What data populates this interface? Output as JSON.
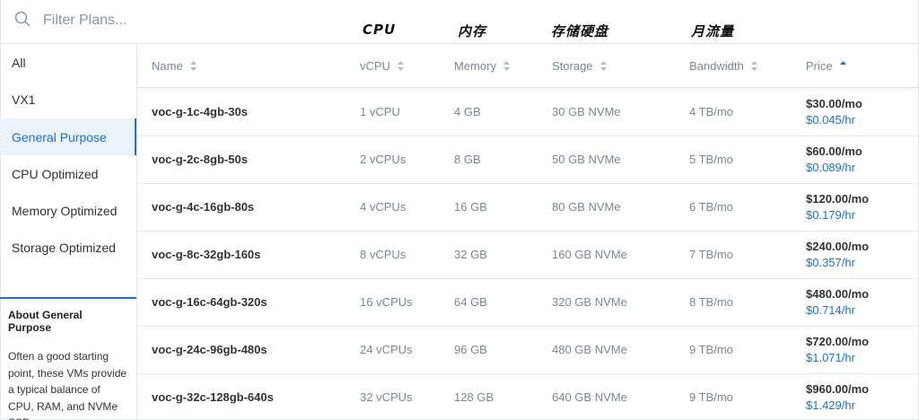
{
  "search": {
    "placeholder": "Filter Plans..."
  },
  "annotations": {
    "cpu": "CPU",
    "memory": "内存",
    "storage": "存储硬盘",
    "bandwidth": "月流量"
  },
  "sidebar": {
    "items": [
      {
        "label": "All"
      },
      {
        "label": "VX1"
      },
      {
        "label": "General Purpose"
      },
      {
        "label": "CPU Optimized"
      },
      {
        "label": "Memory Optimized"
      },
      {
        "label": "Storage Optimized"
      }
    ],
    "active_index": 2,
    "about": {
      "title": "About General Purpose",
      "text": "Often a good starting point, these VMs provide a typical balance of CPU, RAM, and NVMe SSD resources."
    }
  },
  "table": {
    "columns": [
      "Name",
      "vCPU",
      "Memory",
      "Storage",
      "Bandwidth",
      "Price"
    ],
    "sorted_column": "Price",
    "rows": [
      {
        "name": "voc-g-1c-4gb-30s",
        "vcpu": "1 vCPU",
        "memory": "4 GB",
        "storage": "30 GB NVMe",
        "bandwidth": "4 TB/mo",
        "price_mo": "$30.00/mo",
        "price_hr": "$0.045/hr"
      },
      {
        "name": "voc-g-2c-8gb-50s",
        "vcpu": "2 vCPUs",
        "memory": "8 GB",
        "storage": "50 GB NVMe",
        "bandwidth": "5 TB/mo",
        "price_mo": "$60.00/mo",
        "price_hr": "$0.089/hr"
      },
      {
        "name": "voc-g-4c-16gb-80s",
        "vcpu": "4 vCPUs",
        "memory": "16 GB",
        "storage": "80 GB NVMe",
        "bandwidth": "6 TB/mo",
        "price_mo": "$120.00/mo",
        "price_hr": "$0.179/hr"
      },
      {
        "name": "voc-g-8c-32gb-160s",
        "vcpu": "8 vCPUs",
        "memory": "32 GB",
        "storage": "160 GB NVMe",
        "bandwidth": "7 TB/mo",
        "price_mo": "$240.00/mo",
        "price_hr": "$0.357/hr"
      },
      {
        "name": "voc-g-16c-64gb-320s",
        "vcpu": "16 vCPUs",
        "memory": "64 GB",
        "storage": "320 GB NVMe",
        "bandwidth": "8 TB/mo",
        "price_mo": "$480.00/mo",
        "price_hr": "$0.714/hr"
      },
      {
        "name": "voc-g-24c-96gb-480s",
        "vcpu": "24 vCPUs",
        "memory": "96 GB",
        "storage": "480 GB NVMe",
        "bandwidth": "9 TB/mo",
        "price_mo": "$720.00/mo",
        "price_hr": "$1.071/hr"
      },
      {
        "name": "voc-g-32c-128gb-640s",
        "vcpu": "32 vCPUs",
        "memory": "128 GB",
        "storage": "640 GB NVMe",
        "bandwidth": "9 TB/mo",
        "price_mo": "$960.00/mo",
        "price_hr": "$1.429/hr"
      }
    ]
  },
  "colors": {
    "accent": "#1e72d0",
    "muted_text": "#7a8794",
    "active_bg": "#eaf2fb"
  }
}
